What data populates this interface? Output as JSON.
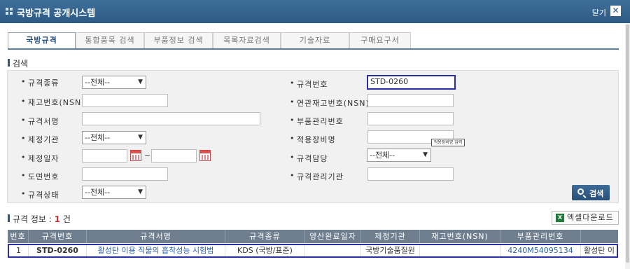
{
  "window": {
    "title": "국방규격 공개시스템",
    "close_label": "닫기",
    "close_icon": "✕"
  },
  "tabs": [
    {
      "label": "국방규격",
      "active": true
    },
    {
      "label": "통합품목 검색"
    },
    {
      "label": "부품정보 검색"
    },
    {
      "label": "목록자료검색"
    },
    {
      "label": "기술자료"
    },
    {
      "label": "구매요구서"
    }
  ],
  "search": {
    "section_title": "검색",
    "fields": {
      "spec_type": {
        "label": "규격종류",
        "value": "--전체--"
      },
      "spec_number": {
        "label": "규격번호",
        "value": "STD-0260"
      },
      "stock_number": {
        "label": "재고번호(NSN)",
        "value": ""
      },
      "related_stock_number": {
        "label": "연관재고번호(NSN)",
        "value": ""
      },
      "spec_name": {
        "label": "규격서명",
        "value": ""
      },
      "part_control_number": {
        "label": "부품관리번호",
        "value": ""
      },
      "issuing_agency": {
        "label": "제정기관",
        "value": "--전체--"
      },
      "applied_equipment": {
        "label": "적용장비명",
        "value": "",
        "tooltip": "적용장비명 입력"
      },
      "issue_date": {
        "label": "제정일자",
        "from": "",
        "to": "",
        "separator": "~"
      },
      "spec_manager": {
        "label": "규격담당",
        "value": "--전체--"
      },
      "drawing_number": {
        "label": "도면번호",
        "value": ""
      },
      "spec_mgmt_agency": {
        "label": "규격관리기관",
        "value": ""
      },
      "spec_status": {
        "label": "규격상태",
        "value": "--전체--"
      }
    },
    "search_button": "검색"
  },
  "results": {
    "title": "규격 정보 :",
    "count": "1",
    "count_unit": "건",
    "excel_button": "엑셀다운로드",
    "excel_icon_text": "X",
    "columns": [
      "번호",
      "규격번호",
      "규격서명",
      "규격종류",
      "양산완료일자",
      "제정기관",
      "재고번호(NSN)",
      "부품관리번호",
      ""
    ],
    "rows": [
      {
        "no": "1",
        "spec_number": "STD-0260",
        "spec_name": "활성탄 이용 직물의 흡착성능 시험법",
        "spec_type": "KDS (국방/표준)",
        "mass_prod_date": "",
        "agency": "국방기술품질원",
        "nsn": "",
        "part_number": "4240M54095134",
        "extra": "활성탄 이"
      }
    ]
  }
}
